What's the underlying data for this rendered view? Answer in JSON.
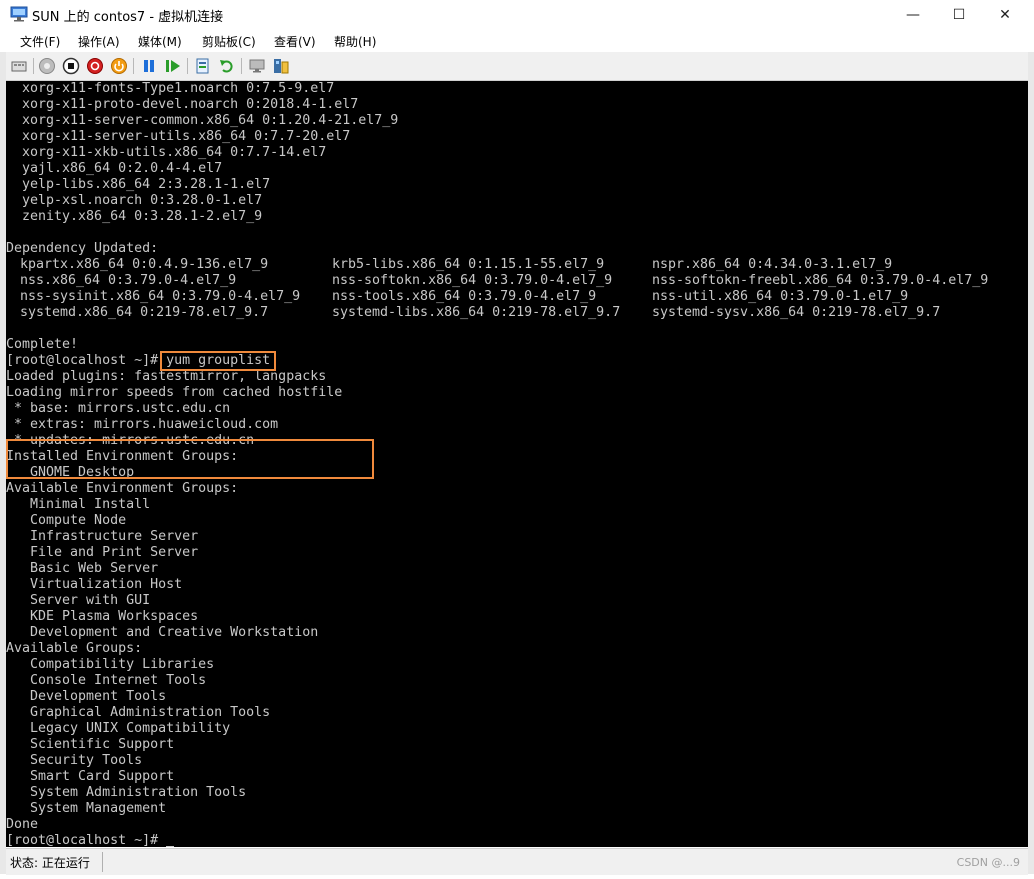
{
  "window": {
    "title": "SUN 上的 contos7 - 虚拟机连接",
    "minimize": "—",
    "maximize": "☐",
    "close": "✕"
  },
  "menu": [
    "文件(F)",
    "操作(A)",
    "媒体(M)",
    "剪贴板(C)",
    "查看(V)",
    "帮助(H)"
  ],
  "toolbar": {
    "icons": [
      "ctrl-alt-del-icon",
      "start-icon",
      "turn-off-icon",
      "shut-down-icon",
      "power-icon",
      "pause-icon",
      "resume-icon",
      "checkpoint-icon",
      "revert-icon",
      "enhanced-session-icon",
      "share-icon"
    ]
  },
  "terminal": {
    "lines": [
      "  xorg-x11-fonts-Type1.noarch 0:7.5-9.el7",
      "  xorg-x11-proto-devel.noarch 0:2018.4-1.el7",
      "  xorg-x11-server-common.x86_64 0:1.20.4-21.el7_9",
      "  xorg-x11-server-utils.x86_64 0:7.7-20.el7",
      "  xorg-x11-xkb-utils.x86_64 0:7.7-14.el7",
      "  yajl.x86_64 0:2.0.4-4.el7",
      "  yelp-libs.x86_64 2:3.28.1-1.el7",
      "  yelp-xsl.noarch 0:3.28.0-1.el7",
      "  zenity.x86_64 0:3.28.1-2.el7_9",
      "",
      "Dependency Updated:"
    ],
    "dependency_table": [
      [
        "kpartx.x86_64 0:0.4.9-136.el7_9",
        "krb5-libs.x86_64 0:1.15.1-55.el7_9",
        "nspr.x86_64 0:4.34.0-3.1.el7_9"
      ],
      [
        "nss.x86_64 0:3.79.0-4.el7_9",
        "nss-softokn.x86_64 0:3.79.0-4.el7_9",
        "nss-softokn-freebl.x86_64 0:3.79.0-4.el7_9"
      ],
      [
        "nss-sysinit.x86_64 0:3.79.0-4.el7_9",
        "nss-tools.x86_64 0:3.79.0-4.el7_9",
        "nss-util.x86_64 0:3.79.0-1.el7_9"
      ],
      [
        "systemd.x86_64 0:219-78.el7_9.7",
        "systemd-libs.x86_64 0:219-78.el7_9.7",
        "systemd-sysv.x86_64 0:219-78.el7_9.7"
      ]
    ],
    "lines_after": [
      "",
      "Complete!",
      "[root@localhost ~]# yum grouplist",
      "Loaded plugins: fastestmirror, langpacks",
      "Loading mirror speeds from cached hostfile",
      " * base: mirrors.ustc.edu.cn",
      " * extras: mirrors.huaweicloud.com",
      " * updates: mirrors.ustc.edu.cn",
      "Installed Environment Groups:",
      "   GNOME Desktop",
      "Available Environment Groups:",
      "   Minimal Install",
      "   Compute Node",
      "   Infrastructure Server",
      "   File and Print Server",
      "   Basic Web Server",
      "   Virtualization Host",
      "   Server with GUI",
      "   KDE Plasma Workspaces",
      "   Development and Creative Workstation",
      "Available Groups:",
      "   Compatibility Libraries",
      "   Console Internet Tools",
      "   Development Tools",
      "   Graphical Administration Tools",
      "   Legacy UNIX Compatibility",
      "   Scientific Support",
      "   Security Tools",
      "   Smart Card Support",
      "   System Administration Tools",
      "   System Management",
      "Done",
      "[root@localhost ~]# "
    ]
  },
  "status": {
    "text": "状态: 正在运行",
    "watermark": "CSDN @...9"
  },
  "colors": {
    "highlight": "#f08a3c",
    "terminal_bg": "#000000",
    "terminal_fg": "#c8c8c8"
  }
}
